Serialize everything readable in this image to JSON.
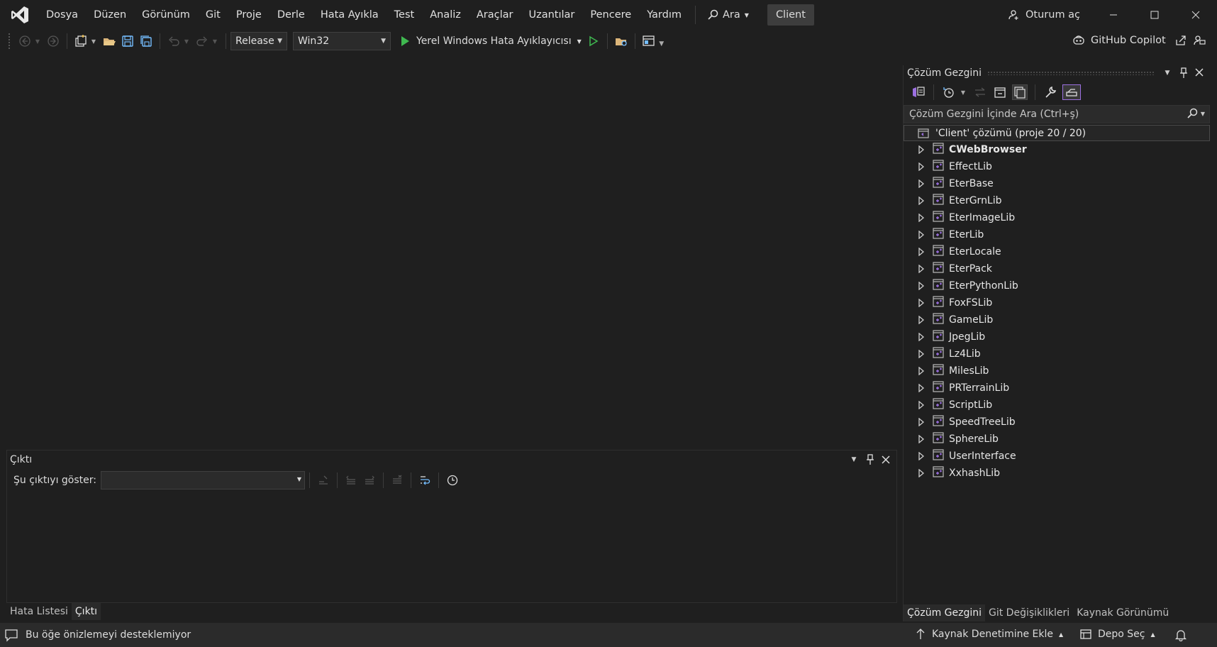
{
  "menu": [
    "Dosya",
    "Düzen",
    "Görünüm",
    "Git",
    "Proje",
    "Derle",
    "Hata Ayıkla",
    "Test",
    "Analiz",
    "Araçlar",
    "Uzantılar",
    "Pencere",
    "Yardım"
  ],
  "search_label": "Ara",
  "solution_chip": "Client",
  "signin_label": "Oturum aç",
  "toolbar": {
    "configuration": "Release",
    "platform": "Win32",
    "debugger_label": "Yerel Windows Hata Ayıklayıcısı",
    "copilot_label": "GitHub Copilot"
  },
  "solution_explorer": {
    "title": "Çözüm Gezgini",
    "search_placeholder": "Çözüm Gezgini İçinde Ara (Ctrl+ş)",
    "root_label": "'Client' çözümü (proje 20 / 20)",
    "projects": [
      {
        "name": "CWebBrowser",
        "bold": true
      },
      {
        "name": "EffectLib"
      },
      {
        "name": "EterBase"
      },
      {
        "name": "EterGrnLib"
      },
      {
        "name": "EterImageLib"
      },
      {
        "name": "EterLib"
      },
      {
        "name": "EterLocale"
      },
      {
        "name": "EterPack"
      },
      {
        "name": "EterPythonLib"
      },
      {
        "name": "FoxFSLib"
      },
      {
        "name": "GameLib"
      },
      {
        "name": "JpegLib"
      },
      {
        "name": "Lz4Lib"
      },
      {
        "name": "MilesLib"
      },
      {
        "name": "PRTerrainLib"
      },
      {
        "name": "ScriptLib"
      },
      {
        "name": "SpeedTreeLib"
      },
      {
        "name": "SphereLib"
      },
      {
        "name": "UserInterface"
      },
      {
        "name": "XxhashLib"
      }
    ],
    "tabs": [
      "Çözüm Gezgini",
      "Git Değişiklikleri",
      "Kaynak Görünümü"
    ]
  },
  "output": {
    "title": "Çıktı",
    "show_label": "Şu çıktıyı göster:",
    "selected_source": ""
  },
  "bottom_tabs": [
    "Hata Listesi",
    "Çıktı"
  ],
  "status": {
    "message": "Bu öğe önizlemeyi desteklemiyor",
    "source_control": "Kaynak Denetimine Ekle",
    "repo": "Depo Seç"
  },
  "colors": {
    "accent": "#9b70e0",
    "play_green": "#3fb950",
    "background": "#1f1f1f"
  }
}
